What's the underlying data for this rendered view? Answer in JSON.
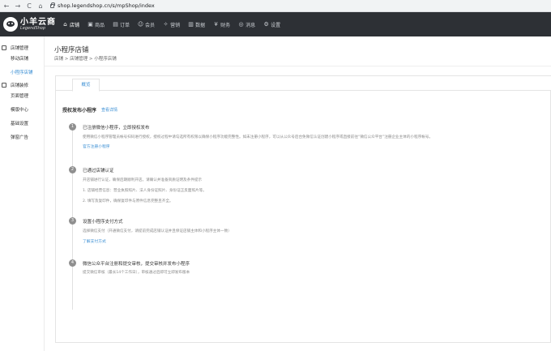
{
  "browser": {
    "back": "←",
    "forward": "→",
    "reload": "C",
    "home": "⌂",
    "url": "shop.legendshop.cn/s/mpShop/index"
  },
  "logo": {
    "cn": "小羊云商",
    "en": "LegendShop"
  },
  "topnav": {
    "items": [
      {
        "label": "店铺",
        "icon": "store-icon"
      },
      {
        "label": "商品",
        "icon": "goods-icon"
      },
      {
        "label": "订单",
        "icon": "order-icon"
      },
      {
        "label": "会员",
        "icon": "member-icon"
      },
      {
        "label": "营销",
        "icon": "marketing-icon"
      },
      {
        "label": "数据",
        "icon": "data-icon"
      },
      {
        "label": "财务",
        "icon": "finance-icon"
      },
      {
        "label": "消息",
        "icon": "message-icon"
      },
      {
        "label": "设置",
        "icon": "settings-icon"
      }
    ]
  },
  "sidebar": {
    "group1": "店铺管理",
    "item1": "移动店铺",
    "item2": "小程序店铺",
    "group2": "店铺装修",
    "item3": "页面管理",
    "item4": "模版中心",
    "item5": "基础设置",
    "item6": "弹窗广告"
  },
  "page": {
    "title": "小程序店铺",
    "breadcrumb": "店铺 > 店铺管理 > 小程序店铺"
  },
  "tabs": {
    "overview": "概览"
  },
  "section": {
    "title": "授权发布小程序",
    "link": "查看详情"
  },
  "steps": [
    {
      "num": "1",
      "title": "已注册微信小程序，立即授权发布",
      "desc": [
        "使用微信小程序管理员帐号扫码进行授权，授权过程中请勾选所有权限以确保小程序功能完整性。如未注册小程序，可以从公众号后台免微信认证创建小程序或直接前往“微信公众平台”注册企业主体的小程序帐号。"
      ],
      "link": "官方注册小程序"
    },
    {
      "num": "2",
      "title": "已通过店铺认证",
      "desc": [
        "开店铺进行认证，确保后期顺利开店。请确认并准备资质证明及条件提示",
        "1. 店铺经营信息：营业执照照片、法人身份证照片、身份证正反面照片等。",
        "2. 填写及复印件，确保复印件与原件信息完整且齐全。"
      ],
      "link": ""
    },
    {
      "num": "3",
      "title": "设置小程序支付方式",
      "desc": [
        "选择微信支付（开通微信支付，请提前完成店铺认证并且保证店铺主体和小程序主体一致）"
      ],
      "link": "了解支付方式"
    },
    {
      "num": "4",
      "title": "微信公众平台注册和提交审核，提交审核并发布小程序",
      "desc": [
        "提交微信审核（最长14个工作日），审核通过后即可立即发布版本"
      ],
      "link": ""
    }
  ]
}
